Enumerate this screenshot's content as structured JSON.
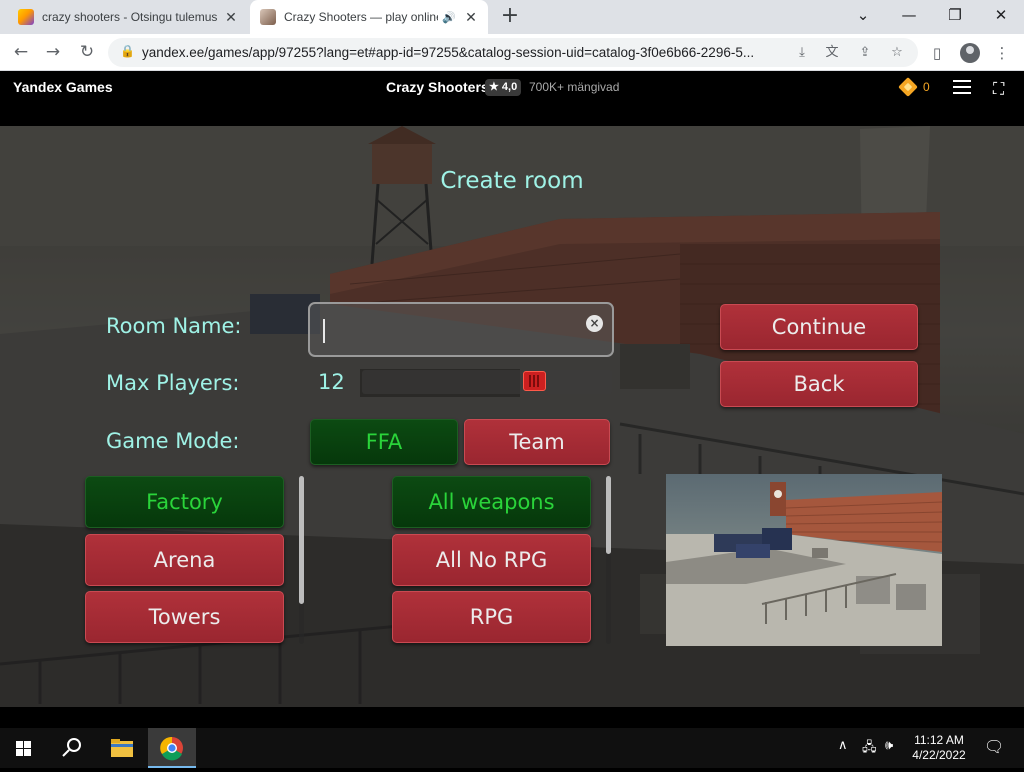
{
  "browser": {
    "tabs": [
      {
        "title": "crazy shooters - Otsingu tulemus",
        "active": false
      },
      {
        "title": "Crazy Shooters — play online",
        "active": true
      }
    ],
    "url": "yandex.ee/games/app/97255?lang=et#app-id=97255&catalog-session-uid=catalog-3f0e6b66-2296-5..."
  },
  "yandex": {
    "logo": "Yandex Games",
    "game_title": "Crazy Shooters",
    "rating": "★ 4,0",
    "players": "700K+ mängivad",
    "coins": "0"
  },
  "game": {
    "title": "Create room",
    "room_name_label": "Room Name:",
    "room_name_value": "",
    "max_players_label": "Max Players:",
    "max_players_value": "12",
    "game_mode_label": "Game Mode:",
    "continue_label": "Continue",
    "back_label": "Back",
    "modes": [
      {
        "label": "FFA",
        "selected": true
      },
      {
        "label": "Team",
        "selected": false
      }
    ],
    "maps": [
      {
        "label": "Factory",
        "selected": true
      },
      {
        "label": "Arena",
        "selected": false
      },
      {
        "label": "Towers",
        "selected": false
      }
    ],
    "weapons": [
      {
        "label": "All weapons",
        "selected": true
      },
      {
        "label": "All No RPG",
        "selected": false
      },
      {
        "label": "RPG",
        "selected": false
      }
    ]
  },
  "taskbar": {
    "time": "11:12 AM",
    "date": "4/22/2022"
  },
  "colors": {
    "accent_text": "#9ff2e6",
    "button_red": "#a12a33",
    "button_green": "#0a4210",
    "green_text": "#2ad43a"
  }
}
